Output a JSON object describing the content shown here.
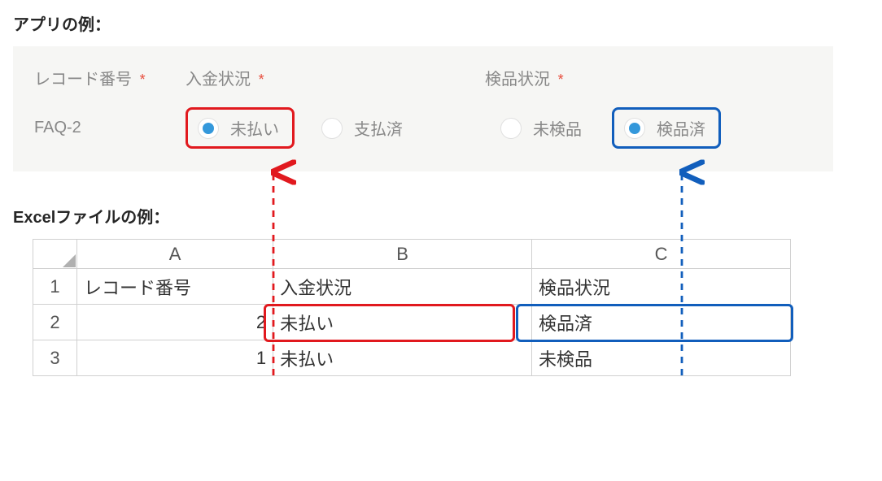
{
  "headings": {
    "app_example": "アプリの例：",
    "excel_example": "Excelファイルの例："
  },
  "fields": {
    "record_no": {
      "label": "レコード番号",
      "value": "FAQ-2"
    },
    "payment": {
      "label": "入金状況",
      "options": [
        {
          "label": "未払い",
          "selected": true,
          "highlight": "red"
        },
        {
          "label": "支払済",
          "selected": false,
          "highlight": null
        }
      ]
    },
    "inspection": {
      "label": "検品状況",
      "options": [
        {
          "label": "未検品",
          "selected": false,
          "highlight": null
        },
        {
          "label": "検品済",
          "selected": true,
          "highlight": "blue"
        }
      ]
    }
  },
  "excel": {
    "columns": [
      "A",
      "B",
      "C"
    ],
    "row_nums": [
      "1",
      "2",
      "3"
    ],
    "header_row": {
      "a": "レコード番号",
      "b": "入金状況",
      "c": "検品状況"
    },
    "rows": [
      {
        "a": "2",
        "b": "未払い",
        "c": "検品済"
      },
      {
        "a": "1",
        "b": "未払い",
        "c": "未検品"
      }
    ],
    "highlights": {
      "row2_b": "red",
      "row2_c": "blue"
    }
  },
  "colors": {
    "highlight_red": "#e1191e",
    "highlight_blue": "#115ebc",
    "radio_selected": "#3498db",
    "required_mark": "#e74c3c"
  }
}
